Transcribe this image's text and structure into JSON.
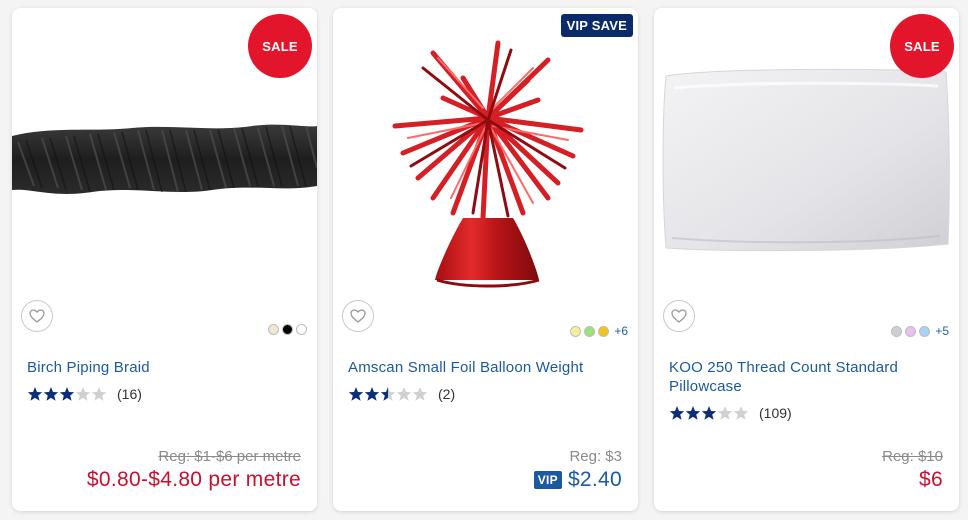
{
  "products": [
    {
      "badge": "SALE",
      "image": "black-rope-braid",
      "swatch_colors": [
        "#efe6d6",
        "#000000",
        "#ffffff"
      ],
      "swatch_more": "",
      "title": "Birch Piping Braid",
      "rating": 3,
      "review_count": "(16)",
      "reg_price": "Reg: $1-$6 per metre",
      "price": "$0.80-$4.80 per metre"
    },
    {
      "badge": "VIP SAVE",
      "image": "red-foil-balloon-weight",
      "swatch_colors": [
        "#f3f09a",
        "#9ee07a",
        "#f5c21a"
      ],
      "swatch_more": "+6",
      "title": "Amscan Small Foil Balloon Weight",
      "rating": 2.5,
      "review_count": "(2)",
      "reg_price": "Reg: $3",
      "vip_label": "VIP",
      "price": "$2.40"
    },
    {
      "badge": "SALE",
      "image": "white-pillowcase",
      "swatch_colors": [
        "#cfcfcf",
        "#e7c0ef",
        "#a9d3f2"
      ],
      "swatch_more": "+5",
      "title": "KOO 250 Thread Count Standard Pillowcase",
      "rating": 3,
      "review_count": "(109)",
      "reg_price": "Reg: $10",
      "price": "$6"
    }
  ],
  "colors": {
    "sale_red": "#e3152b",
    "vip_navy": "#0a2a6a",
    "link_blue": "#1b5aa0",
    "star_navy": "#0b2d7a"
  },
  "icons": {
    "favorite": "heart-outline-icon",
    "star": "star-icon"
  }
}
